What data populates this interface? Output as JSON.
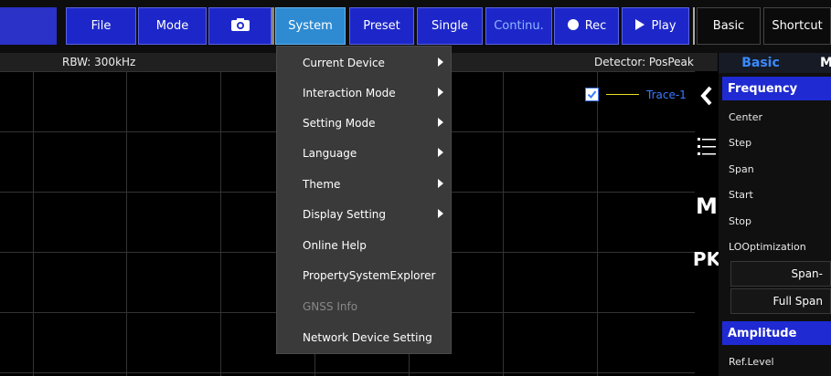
{
  "toolbar": {
    "file": "File",
    "mode": "Mode",
    "camera_icon": "camera-icon",
    "system": "System",
    "preset": "Preset",
    "single": "Single",
    "continu": "Continu.",
    "rec": "Rec",
    "play": "Play",
    "basic": "Basic",
    "shortcut": "Shortcut"
  },
  "statusbar": {
    "rbw": "RBW: 300kHz",
    "detector": "Detector: PosPeak"
  },
  "trace": {
    "label": "Trace-1",
    "checked": true,
    "line_color": "#e6e028",
    "label_color": "#3a7bff"
  },
  "sideicons": {
    "back": "back-chevron-icon",
    "list": "list-icon",
    "m_label": "M",
    "pk_label": "PK"
  },
  "right_panel": {
    "tab_basic": "Basic",
    "tab_next": "M",
    "frequency": {
      "title": "Frequency",
      "items": [
        "Center",
        "Step",
        "Span",
        "Start",
        "Stop",
        "LOOptimization"
      ],
      "buttons": [
        "Span-",
        "Full Span"
      ]
    },
    "amplitude": {
      "title": "Amplitude",
      "items": [
        "Ref.Level"
      ]
    }
  },
  "dropdown": {
    "items": [
      {
        "label": "Current Device",
        "submenu": true,
        "enabled": true
      },
      {
        "label": "Interaction Mode",
        "submenu": true,
        "enabled": true
      },
      {
        "label": "Setting Mode",
        "submenu": true,
        "enabled": true
      },
      {
        "label": "Language",
        "submenu": true,
        "enabled": true
      },
      {
        "label": "Theme",
        "submenu": true,
        "enabled": true
      },
      {
        "label": "Display Setting",
        "submenu": true,
        "enabled": true
      },
      {
        "label": "Online Help",
        "submenu": false,
        "enabled": true
      },
      {
        "label": "PropertySystemExplorer",
        "submenu": false,
        "enabled": true
      },
      {
        "label": "GNSS Info",
        "submenu": false,
        "enabled": false
      },
      {
        "label": "Network Device Setting",
        "submenu": false,
        "enabled": true
      }
    ]
  },
  "colors": {
    "toolbar_button": "#1d27c9",
    "active_button": "#2e8bd2",
    "panel_header": "#1f2ad2",
    "menu_bg": "#3a3a3a"
  }
}
